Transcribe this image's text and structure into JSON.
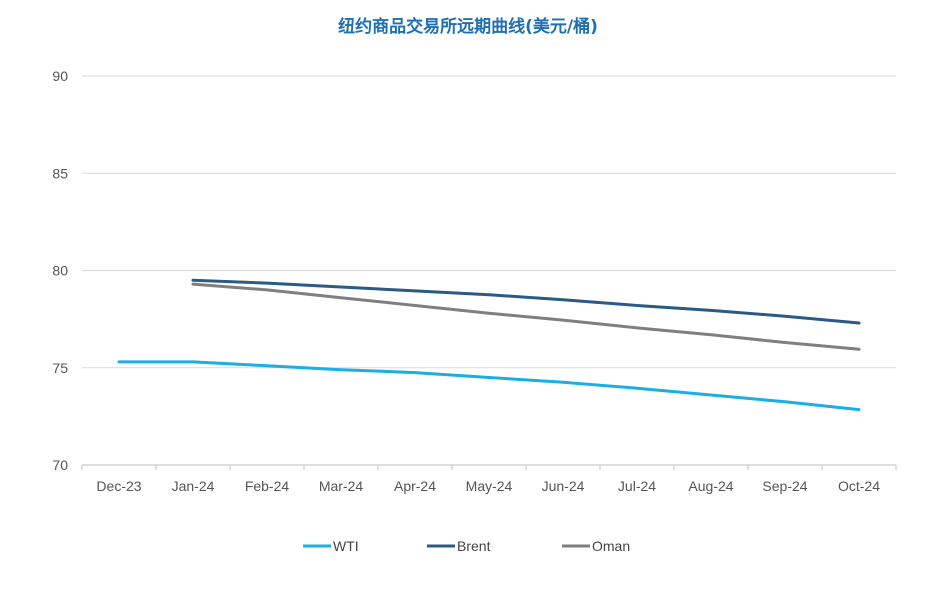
{
  "chart_data": {
    "type": "line",
    "title": "纽约商品交易所远期曲线(美元/桶)",
    "xlabel": "",
    "ylabel": "",
    "categories": [
      "Dec-23",
      "Jan-24",
      "Feb-24",
      "Mar-24",
      "Apr-24",
      "May-24",
      "Jun-24",
      "Jul-24",
      "Aug-24",
      "Sep-24",
      "Oct-24"
    ],
    "ylim": [
      70,
      90
    ],
    "yticks": [
      70,
      75,
      80,
      85,
      90
    ],
    "grid": true,
    "legend": "bottom",
    "series": [
      {
        "name": "WTI",
        "color": "#1aaee5",
        "values": [
          75.3,
          75.3,
          75.1,
          74.9,
          74.75,
          74.5,
          74.25,
          73.95,
          73.6,
          73.25,
          72.85
        ]
      },
      {
        "name": "Brent",
        "color": "#2b5a84",
        "values": [
          null,
          79.5,
          79.35,
          79.15,
          78.95,
          78.75,
          78.5,
          78.2,
          77.95,
          77.65,
          77.3
        ]
      },
      {
        "name": "Oman",
        "color": "#7f7f7f",
        "values": [
          null,
          79.3,
          79.0,
          78.6,
          78.2,
          77.8,
          77.45,
          77.05,
          76.7,
          76.3,
          75.95
        ]
      }
    ]
  }
}
